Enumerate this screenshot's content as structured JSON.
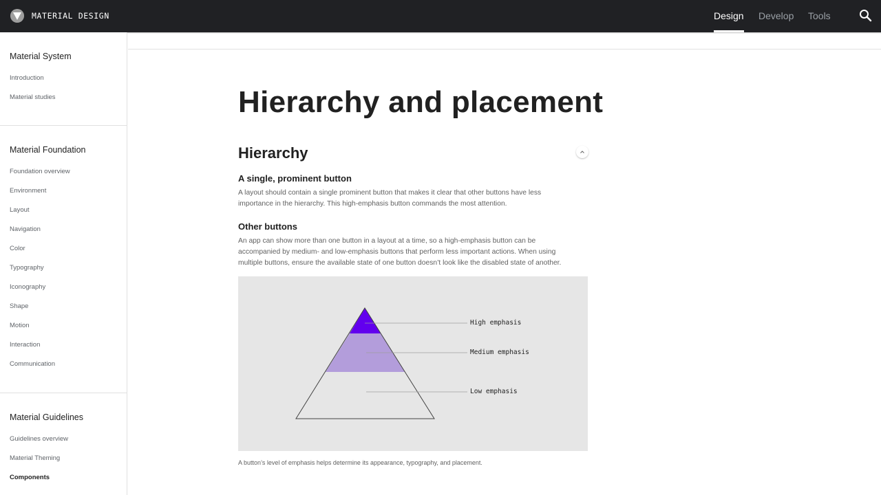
{
  "topbar": {
    "brand": "MATERIAL DESIGN",
    "nav": {
      "design": "Design",
      "develop": "Develop",
      "tools": "Tools"
    },
    "active": "Design",
    "icons": {
      "logo": "material-logo-icon",
      "search": "search-icon"
    }
  },
  "sidebar": {
    "system": {
      "heading": "Material System",
      "items": [
        "Introduction",
        "Material studies"
      ]
    },
    "foundation": {
      "heading": "Material Foundation",
      "items": [
        "Foundation overview",
        "Environment",
        "Layout",
        "Navigation",
        "Color",
        "Typography",
        "Iconography",
        "Shape",
        "Motion",
        "Interaction",
        "Communication"
      ]
    },
    "guidelines": {
      "heading": "Material Guidelines",
      "items": [
        "Guidelines overview",
        "Material Theming",
        "Components"
      ],
      "active": "Components"
    }
  },
  "main": {
    "title": "Hierarchy and placement",
    "section": {
      "title": "Hierarchy",
      "collapse_icon": "chevron-up-icon"
    },
    "blocks": [
      {
        "title": "A single, prominent button",
        "lines": [
          "A layout should contain a single prominent button that makes it clear that other buttons have less",
          "importance in the hierarchy. This high-emphasis button commands the most attention."
        ]
      },
      {
        "title": "Other buttons",
        "lines": [
          "An app can show more than one button in a layout at a time, so a high-emphasis button can be",
          "accompanied by medium- and low-emphasis buttons that perform less important actions. When using",
          "multiple buttons, ensure the available state of one button doesn’t look like the disabled state of another."
        ]
      }
    ],
    "figure": {
      "labels": {
        "high": "High emphasis",
        "medium": "Medium emphasis",
        "low": "Low emphasis"
      },
      "colors": {
        "background": "#e6e6e6",
        "high": "#6200ee",
        "medium": "#b39ddb",
        "low": "#e6e6e6"
      }
    },
    "caption": "A button’s level of emphasis helps determine its appearance, typography, and placement."
  }
}
